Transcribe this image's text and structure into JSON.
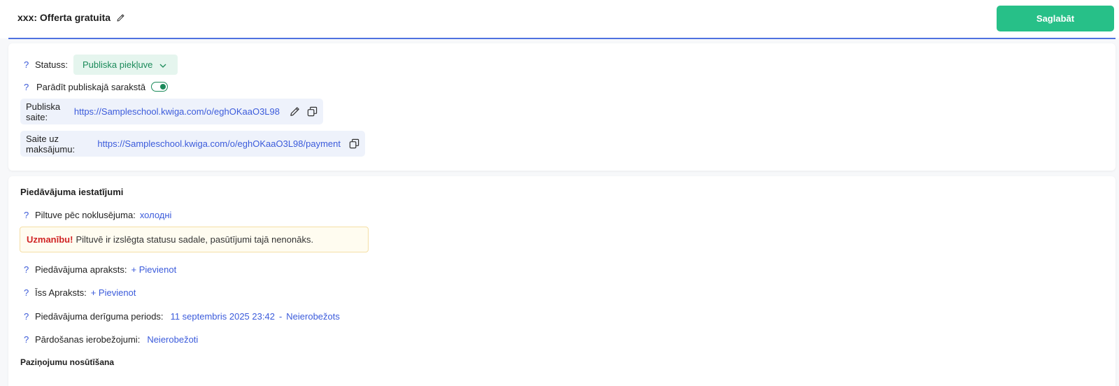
{
  "header": {
    "title": "xxx: Offerta gratuita",
    "save_label": "Saglabāt"
  },
  "status_card": {
    "help_mark": "?",
    "status_label": "Statuss:",
    "status_value": "Publiska piekļuve",
    "show_public_label": "Parādīt publiskajā sarakstā",
    "show_public_enabled": true,
    "public_link_label": "Publiska saite:",
    "public_link_url": "https://Sampleschool.kwiga.com/o/eghOKaaO3L98",
    "payment_link_label": "Saite uz maksājumu:",
    "payment_link_url": "https://Sampleschool.kwiga.com/o/eghOKaaO3L98/payment"
  },
  "settings": {
    "title": "Piedāvājuma iestatījumi",
    "funnel_label": "Piltuve pēc noklusējuma:",
    "funnel_value": "холодні",
    "warning_strong": "Uzmanību!",
    "warning_text": "Piltuvē ir izslēgta statusu sadale, pasūtījumi tajā nenonāks.",
    "description_label": "Piedāvājuma apraksts:",
    "description_action": "+ Pievienot",
    "short_desc_label": "Īss Apraksts:",
    "short_desc_action": "+ Pievienot",
    "validity_label": "Piedāvājuma derīguma periods:",
    "validity_start": "11 septembris 2025 23:42",
    "validity_sep": "-",
    "validity_end": "Neierobežots",
    "sales_limit_label": "Pārdošanas ierobežojumi:",
    "sales_limit_value": "Neierobežoti",
    "notifications_title": "Paziņojumu nosūtīšana"
  },
  "colors": {
    "accent": "#27c088",
    "link": "#3b5bdb",
    "status_bg": "#e5f5ee",
    "status_text": "#1b8a5a",
    "warning_red": "#d02424"
  }
}
